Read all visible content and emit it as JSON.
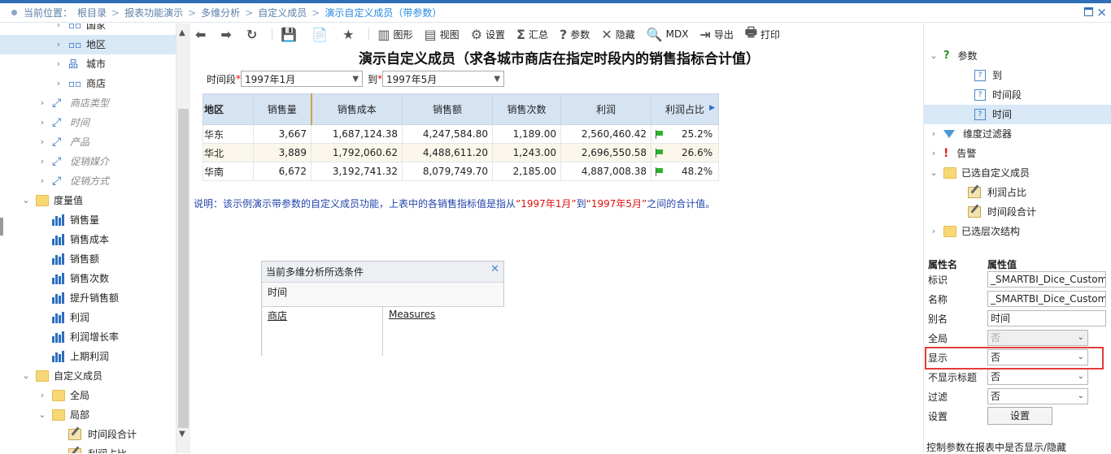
{
  "breadcrumb": {
    "prefix": "当前位置：",
    "items": [
      "根目录",
      "报表功能演示",
      "多维分析",
      "自定义成员"
    ],
    "current": "演示自定义成员（带参数）"
  },
  "left_tree": [
    {
      "label": "国家",
      "icon": "dim-icon",
      "chev": ">",
      "indent": 66,
      "italic": false
    },
    {
      "label": "地区",
      "icon": "dim-icon",
      "chev": ">",
      "indent": 66,
      "italic": false,
      "selected": true
    },
    {
      "label": "城市",
      "icon": "hierarchy-icon",
      "chev": ">",
      "indent": 66,
      "italic": false
    },
    {
      "label": "商店",
      "icon": "dim-icon",
      "chev": ">",
      "indent": 66,
      "italic": false
    },
    {
      "label": "商店类型",
      "icon": "axis-icon",
      "chev": ">",
      "indent": 46,
      "italic": true
    },
    {
      "label": "时间",
      "icon": "axis-icon",
      "chev": ">",
      "indent": 46,
      "italic": true
    },
    {
      "label": "产品",
      "icon": "axis-icon",
      "chev": ">",
      "indent": 46,
      "italic": true
    },
    {
      "label": "促销媒介",
      "icon": "axis-icon",
      "chev": ">",
      "indent": 46,
      "italic": true
    },
    {
      "label": "促销方式",
      "icon": "axis-icon",
      "chev": ">",
      "indent": 46,
      "italic": true
    },
    {
      "label": "度量值",
      "icon": "folder-icon",
      "chev": "v",
      "indent": 26,
      "italic": false
    },
    {
      "label": "销售量",
      "icon": "bars-icon",
      "chev": "",
      "indent": 46,
      "italic": false
    },
    {
      "label": "销售成本",
      "icon": "bars-icon",
      "chev": "",
      "indent": 46,
      "italic": false
    },
    {
      "label": "销售额",
      "icon": "bars-icon",
      "chev": "",
      "indent": 46,
      "italic": false
    },
    {
      "label": "销售次数",
      "icon": "bars-icon",
      "chev": "",
      "indent": 46,
      "italic": false
    },
    {
      "label": "提升销售额",
      "icon": "bars-icon",
      "chev": "",
      "indent": 46,
      "italic": false
    },
    {
      "label": "利润",
      "icon": "bars-icon",
      "chev": "",
      "indent": 46,
      "italic": false
    },
    {
      "label": "利润增长率",
      "icon": "bars-icon",
      "chev": "",
      "indent": 46,
      "italic": false
    },
    {
      "label": "上期利润",
      "icon": "bars-icon",
      "chev": "",
      "indent": 46,
      "italic": false
    },
    {
      "label": "自定义成员",
      "icon": "folder-icon",
      "chev": "v",
      "indent": 26,
      "italic": false
    },
    {
      "label": "全局",
      "icon": "folder-icon",
      "chev": ">",
      "indent": 46,
      "italic": false
    },
    {
      "label": "局部",
      "icon": "folder-icon",
      "chev": "v",
      "indent": 46,
      "italic": false
    },
    {
      "label": "时间段合计",
      "icon": "member-icon",
      "chev": "",
      "indent": 66,
      "italic": false
    },
    {
      "label": "利润占比",
      "icon": "member-icon",
      "chev": "",
      "indent": 66,
      "italic": false
    }
  ],
  "toolbar": [
    {
      "glyph": "⬅",
      "label": ""
    },
    {
      "glyph": "➡",
      "label": ""
    },
    {
      "glyph": "↻",
      "label": ""
    },
    {
      "glyph": "💾",
      "label": ""
    },
    {
      "glyph": "📄",
      "label": ""
    },
    {
      "glyph": "★",
      "label": ""
    },
    {
      "glyph": "▥",
      "label": "图形"
    },
    {
      "glyph": "▤",
      "label": "视图"
    },
    {
      "glyph": "⚙",
      "label": "设置"
    },
    {
      "glyph": "Σ",
      "label": "汇总"
    },
    {
      "glyph": "?",
      "label": "参数"
    },
    {
      "glyph": "✕",
      "label": "隐藏"
    },
    {
      "glyph": "🔍",
      "label": "MDX"
    },
    {
      "glyph": "⇥",
      "label": "导出"
    },
    {
      "glyph": "🖶",
      "label": "打印"
    }
  ],
  "report": {
    "title": "演示自定义成员（求各城市商店在指定时段内的销售指标合计值）",
    "param1_label": "时间段",
    "param1_value": "1997年1月",
    "param2_label": "到",
    "param2_value": "1997年5月",
    "required_mark": "*"
  },
  "table": {
    "headers": [
      "地区",
      "销售量",
      "销售成本",
      "销售额",
      "销售次数",
      "利润",
      "利润占比"
    ],
    "rows": [
      {
        "area": "华东",
        "qty": "3,667",
        "cost": "1,687,124.38",
        "sales": "4,247,584.80",
        "count": "1,189.00",
        "profit": "2,560,460.42",
        "ratio": "25.2%"
      },
      {
        "area": "华北",
        "qty": "3,889",
        "cost": "1,792,060.62",
        "sales": "4,488,611.20",
        "count": "1,243.00",
        "profit": "2,696,550.58",
        "ratio": "26.6%"
      },
      {
        "area": "华南",
        "qty": "6,672",
        "cost": "3,192,741.32",
        "sales": "8,079,749.70",
        "count": "2,185.00",
        "profit": "4,887,008.38",
        "ratio": "48.2%"
      }
    ]
  },
  "note": {
    "prefix": "说明：该示例演示带参数的自定义成员功能，上表中的各销售指标值是指从",
    "v1": "“1997年1月”",
    "mid": "到",
    "v2": "“1997年5月”",
    "suffix": "之间的合计值。"
  },
  "conditions": {
    "title": "当前多维分析所选条件",
    "slicer": "时间",
    "rows": "商店",
    "columns": "Measures"
  },
  "right_tree": [
    {
      "label": "参数",
      "icon": "question-icon",
      "chev": "v",
      "indent": 6
    },
    {
      "label": "到",
      "icon": "param-icon",
      "chev": "",
      "indent": 44
    },
    {
      "label": "时间段",
      "icon": "param-icon",
      "chev": "",
      "indent": 44
    },
    {
      "label": "时间",
      "icon": "param-icon",
      "chev": "",
      "indent": 44,
      "selected": true
    },
    {
      "label": "维度过滤器",
      "icon": "funnel-icon",
      "chev": ">",
      "indent": 6
    },
    {
      "label": "告警",
      "icon": "alert-icon",
      "chev": ">",
      "indent": 6
    },
    {
      "label": "已选自定义成员",
      "icon": "folder-icon",
      "chev": "v",
      "indent": 6
    },
    {
      "label": "利润占比",
      "icon": "member-icon",
      "chev": "",
      "indent": 36
    },
    {
      "label": "时间段合计",
      "icon": "member-icon",
      "chev": "",
      "indent": 36
    },
    {
      "label": "已选层次结构",
      "icon": "folder-icon",
      "chev": ">",
      "indent": 6
    }
  ],
  "properties": {
    "header_name": "属性名",
    "header_value": "属性值",
    "rows": [
      {
        "key": "标识",
        "value": "_SMARTBI_Dice_Custom",
        "type": "text"
      },
      {
        "key": "名称",
        "value": "_SMARTBI_Dice_Custom",
        "type": "text"
      },
      {
        "key": "别名",
        "value": "时间",
        "type": "text"
      },
      {
        "key": "全局",
        "value": "否",
        "type": "disabled-select"
      },
      {
        "key": "显示",
        "value": "否",
        "type": "select"
      },
      {
        "key": "不显示标题",
        "value": "否",
        "type": "select"
      },
      {
        "key": "过滤",
        "value": "否",
        "type": "select"
      },
      {
        "key": "设置",
        "value": "设置",
        "type": "button"
      }
    ],
    "hint": "控制参数在报表中是否显示/隐藏"
  }
}
